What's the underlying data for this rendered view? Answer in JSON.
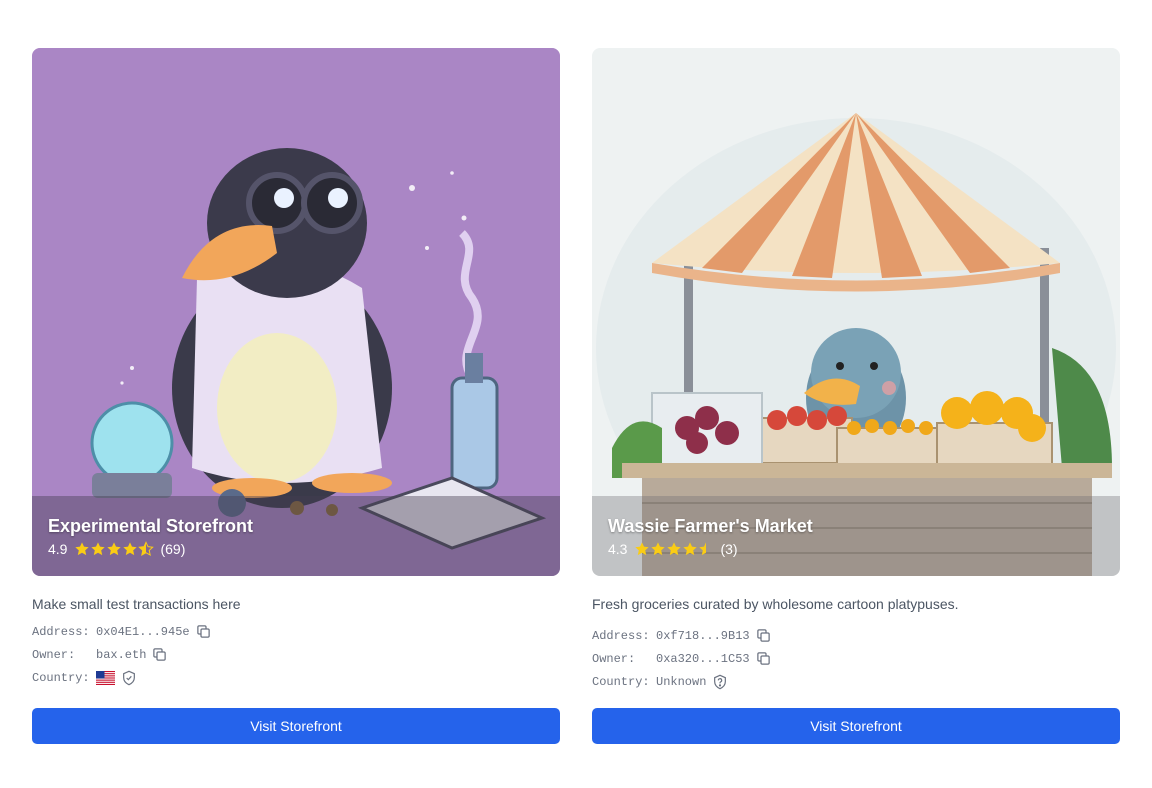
{
  "stores": [
    {
      "name": "Experimental Storefront",
      "rating": "4.9",
      "rating_value": 4.5,
      "review_count": "(69)",
      "description": "Make small test transactions here",
      "address_label": "Address:",
      "address": "0x04E1...945e",
      "owner_label": "Owner:",
      "owner": "bax.eth",
      "country_label": "Country:",
      "country_value": "",
      "country_icon": "us-flag",
      "verification_icon": "shield-check-icon",
      "button_label": "Visit Storefront",
      "image": "platypus-scientist-illustration"
    },
    {
      "name": "Wassie Farmer's Market",
      "rating": "4.3",
      "rating_value": 4.5,
      "review_count": "(3)",
      "description": "Fresh groceries curated by wholesome cartoon platypuses.",
      "address_label": "Address:",
      "address": "0xf718...9B13",
      "owner_label": "Owner:",
      "owner": "0xa320...1C53",
      "country_label": "Country:",
      "country_value": "Unknown",
      "country_icon": "",
      "verification_icon": "shield-question-icon",
      "button_label": "Visit Storefront",
      "image": "platypus-market-stall-illustration"
    }
  ],
  "colors": {
    "button": "#2563eb",
    "star": "#facc15",
    "hero1_bg": "#b08ac8"
  }
}
